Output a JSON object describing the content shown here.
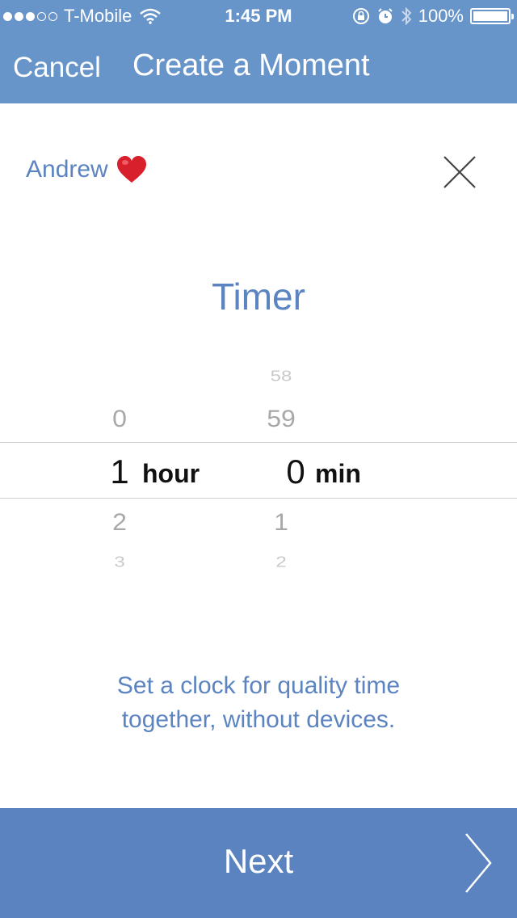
{
  "status_bar": {
    "carrier": "T-Mobile",
    "time": "1:45 PM",
    "battery": "100%",
    "icons": [
      "signal-dots-icon",
      "wifi-icon",
      "rotation-lock-icon",
      "alarm-icon",
      "bluetooth-icon",
      "battery-icon"
    ]
  },
  "nav": {
    "cancel_label": "Cancel",
    "title": "Create a Moment"
  },
  "person": {
    "name": "Andrew",
    "emoji_icon": "red-heart-icon"
  },
  "timer": {
    "title": "Timer",
    "hours": {
      "above_far": "",
      "above": "0",
      "selected": "1",
      "below": "2",
      "below_far": "3",
      "unit": "hour"
    },
    "minutes": {
      "above_far": "58",
      "above": "59",
      "selected": "0",
      "below": "1",
      "below_far": "2",
      "unit": "min"
    }
  },
  "description": {
    "line1": "Set a clock for quality time",
    "line2": "together, without devices."
  },
  "footer": {
    "next_label": "Next"
  },
  "colors": {
    "header_bg": "#6794c9",
    "accent_text": "#5b84c0",
    "footer_bg": "#5b83bf"
  }
}
